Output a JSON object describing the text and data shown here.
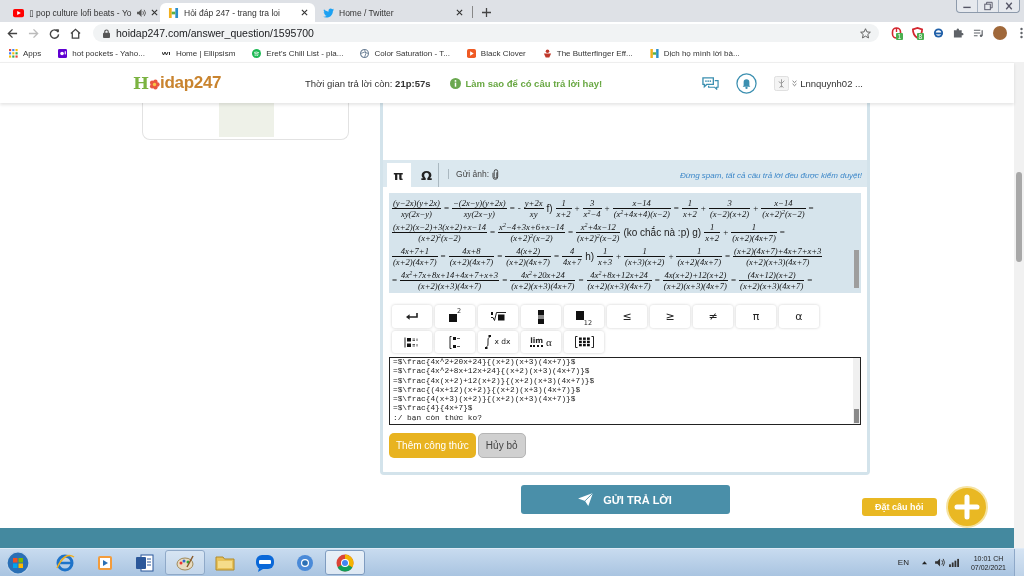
{
  "browser": {
    "tabs": [
      {
        "title": "▯ pop culture lofi beats - Yo",
        "selected": false,
        "audio": true
      },
      {
        "title": "Hỏi đáp 247 - trang tra loi",
        "selected": true,
        "audio": false
      },
      {
        "title": "Home / Twitter",
        "selected": false,
        "audio": false
      }
    ],
    "url": "hoidap247.com/answer_question/1595700",
    "extension_badges": [
      "1",
      "8"
    ],
    "bookmarks": [
      "Apps",
      "hot pockets - Yaho...",
      "Home | Ellipsism",
      "Eret's Chill List - pla...",
      "Color Saturation - T...",
      "Black Clover",
      "The Butterfinger Eff...",
      "Dịch họ mình lời bà..."
    ]
  },
  "header": {
    "logo_initial": "H",
    "logo_rest": "idap247",
    "timer": "Thời gian trả lời còn: **21p:57s**",
    "tip": "Làm sao để có câu trả lời hay!",
    "username": "Lnnquynh02 ..."
  },
  "editor": {
    "tabs": [
      {
        "label": "π",
        "selected": true
      },
      {
        "label": "Ω",
        "selected": false
      }
    ],
    "attach_label": "Gửi ảnh:",
    "notice": "Đừng spam, tất cả câu trả lời đều được kiểm duyệt!",
    "preview_lines": [
      [
        {
          "kind": "frac",
          "num": "(y−2x)(y+2x)",
          "den": "xy(2x−y)"
        },
        {
          "kind": "op",
          "text": "="
        },
        {
          "kind": "frac",
          "num": "−(2x−y)(y+2x)",
          "den": "xy(2x−y)"
        },
        {
          "kind": "op",
          "text": "="
        },
        {
          "kind": "op",
          "text": "-"
        },
        {
          "kind": "frac",
          "num": "y+2x",
          "den": "xy"
        },
        {
          "kind": "text",
          "text": "f)"
        },
        {
          "kind": "frac",
          "num": "1",
          "den": "x+2"
        },
        {
          "kind": "op",
          "text": "+"
        },
        {
          "kind": "frac",
          "num": "3",
          "den": "x$^{2}$−4"
        },
        {
          "kind": "op",
          "text": "+"
        },
        {
          "kind": "frac",
          "num": "x−14",
          "den": "(x$^{2}$+4x+4)(x−2)"
        },
        {
          "kind": "op",
          "text": "="
        },
        {
          "kind": "frac",
          "num": "1",
          "den": "x+2"
        },
        {
          "kind": "op",
          "text": "+"
        },
        {
          "kind": "frac",
          "num": "3",
          "den": "(x−2)(x+2)"
        },
        {
          "kind": "op",
          "text": "+"
        },
        {
          "kind": "frac",
          "num": "x−14",
          "den": "(x+2)$^{2}$(x−2)"
        },
        {
          "kind": "op",
          "text": "="
        }
      ],
      [
        {
          "kind": "frac",
          "num": "(x+2)(x−2)+3(x+2)+x−14",
          "den": "(x+2)$^{2}$(x−2)"
        },
        {
          "kind": "op",
          "text": "="
        },
        {
          "kind": "frac",
          "num": "x$^{2}$−4+3x+6+x−14",
          "den": "(x+2)$^{2}$(x−2)"
        },
        {
          "kind": "op",
          "text": "="
        },
        {
          "kind": "frac",
          "num": "x$^{2}$+4x−12",
          "den": "(x+2)$^{2}$(x−2)"
        },
        {
          "kind": "text",
          "text": "(ko chắc nà :p) g)"
        },
        {
          "kind": "frac",
          "num": "1",
          "den": "x+2"
        },
        {
          "kind": "op",
          "text": "+"
        },
        {
          "kind": "frac",
          "num": "1",
          "den": "(x+2)(4x+7)"
        },
        {
          "kind": "op",
          "text": "="
        }
      ],
      [
        {
          "kind": "frac",
          "num": "4x+7+1",
          "den": "(x+2)(4x+7)"
        },
        {
          "kind": "op",
          "text": "="
        },
        {
          "kind": "frac",
          "num": "4x+8",
          "den": "(x+2)(4x+7)"
        },
        {
          "kind": "op",
          "text": "="
        },
        {
          "kind": "frac",
          "num": "4(x+2)",
          "den": "(x+2)(4x+7)"
        },
        {
          "kind": "op",
          "text": "="
        },
        {
          "kind": "frac",
          "num": "4",
          "den": "4x+7"
        },
        {
          "kind": "text",
          "text": "h)"
        },
        {
          "kind": "frac",
          "num": "1",
          "den": "x+3"
        },
        {
          "kind": "op",
          "text": "+"
        },
        {
          "kind": "frac",
          "num": "1",
          "den": "(x+3)(x+2)"
        },
        {
          "kind": "op",
          "text": "+"
        },
        {
          "kind": "frac",
          "num": "1",
          "den": "(x+2)(4x+7)"
        },
        {
          "kind": "op",
          "text": "="
        },
        {
          "kind": "frac",
          "num": "(x+2)(4x+7)+4x+7+x+3",
          "den": "(x+2)(x+3)(4x+7)"
        }
      ],
      [
        {
          "kind": "op",
          "text": "="
        },
        {
          "kind": "frac",
          "num": "4x$^{2}$+7x+8x+14+4x+7+x+3",
          "den": "(x+2)(x+3)(4x+7)"
        },
        {
          "kind": "op",
          "text": "="
        },
        {
          "kind": "frac",
          "num": "4x$^{2}$+20x+24",
          "den": "(x+2)(x+3)(4x+7)"
        },
        {
          "kind": "op",
          "text": "="
        },
        {
          "kind": "frac",
          "num": "4x$^{2}$+8x+12x+24",
          "den": "(x+2)(x+3)(4x+7)"
        },
        {
          "kind": "op",
          "text": "="
        },
        {
          "kind": "frac",
          "num": "4x(x+2)+12(x+2)",
          "den": "(x+2)(x+3)(4x+7)"
        },
        {
          "kind": "op",
          "text": "="
        },
        {
          "kind": "frac",
          "num": "(4x+12)(x+2)",
          "den": "(x+2)(x+3)(4x+7)"
        },
        {
          "kind": "op",
          "text": "="
        }
      ]
    ],
    "symbol_rows": [
      [
        {
          "kind": "newline"
        },
        {
          "kind": "power",
          "label": "2"
        },
        {
          "kind": "root"
        },
        {
          "kind": "fraction"
        },
        {
          "kind": "subscript",
          "label": "12"
        },
        {
          "kind": "symbol",
          "label": "≤"
        },
        {
          "kind": "symbol",
          "label": "≥"
        },
        {
          "kind": "symbol",
          "label": "≠"
        },
        {
          "kind": "symbol",
          "label": "π"
        },
        {
          "kind": "symbol",
          "label": "α"
        }
      ],
      [
        {
          "kind": "system"
        },
        {
          "kind": "cases"
        },
        {
          "kind": "integral",
          "label": "x dx"
        },
        {
          "kind": "limit",
          "label": "lim",
          "symbol": "α"
        },
        {
          "kind": "matrix"
        }
      ]
    ],
    "latex_input": {
      "value": "=$\\frac{4x^2+20x+24}{(x+2)(x+3)(4x+7)}$\n=$\\frac{4x^2+8x+12x+24}{(x+2)(x+3)(4x+7)}$\n=$\\frac{4x(x+2)+12(x+2)}{(x+2)(x+3)(4x+7)}$\n=$\\frac{(4x+12)(x+2)}{(x+2)(x+3)(4x+7)}$\n=$\\frac{4(x+3)(x+2)}{(x+2)(x+3)(4x+7)}$\n=$\\frac{4}{4x+7}$\n:/ bạn còn thức ko?"
    },
    "buttons": [
      {
        "label": "Thêm công thức",
        "kind": "primary"
      },
      {
        "label": "Hủy bỏ",
        "kind": "secondary"
      }
    ]
  },
  "submit_button": "GỬI TRẢ LỜI",
  "ask_button": "Đặt câu hỏi",
  "taskbar": {
    "apps": [
      {
        "open": false,
        "selected": false
      },
      {
        "open": false,
        "selected": false
      },
      {
        "open": false,
        "selected": false
      },
      {
        "open": true,
        "selected": false
      },
      {
        "open": false,
        "selected": false
      },
      {
        "open": false,
        "selected": false
      },
      {
        "open": false,
        "selected": false
      },
      {
        "open": true,
        "selected": true
      }
    ],
    "language": "EN",
    "time": "10:01 CH",
    "date": "07/02/2021"
  }
}
